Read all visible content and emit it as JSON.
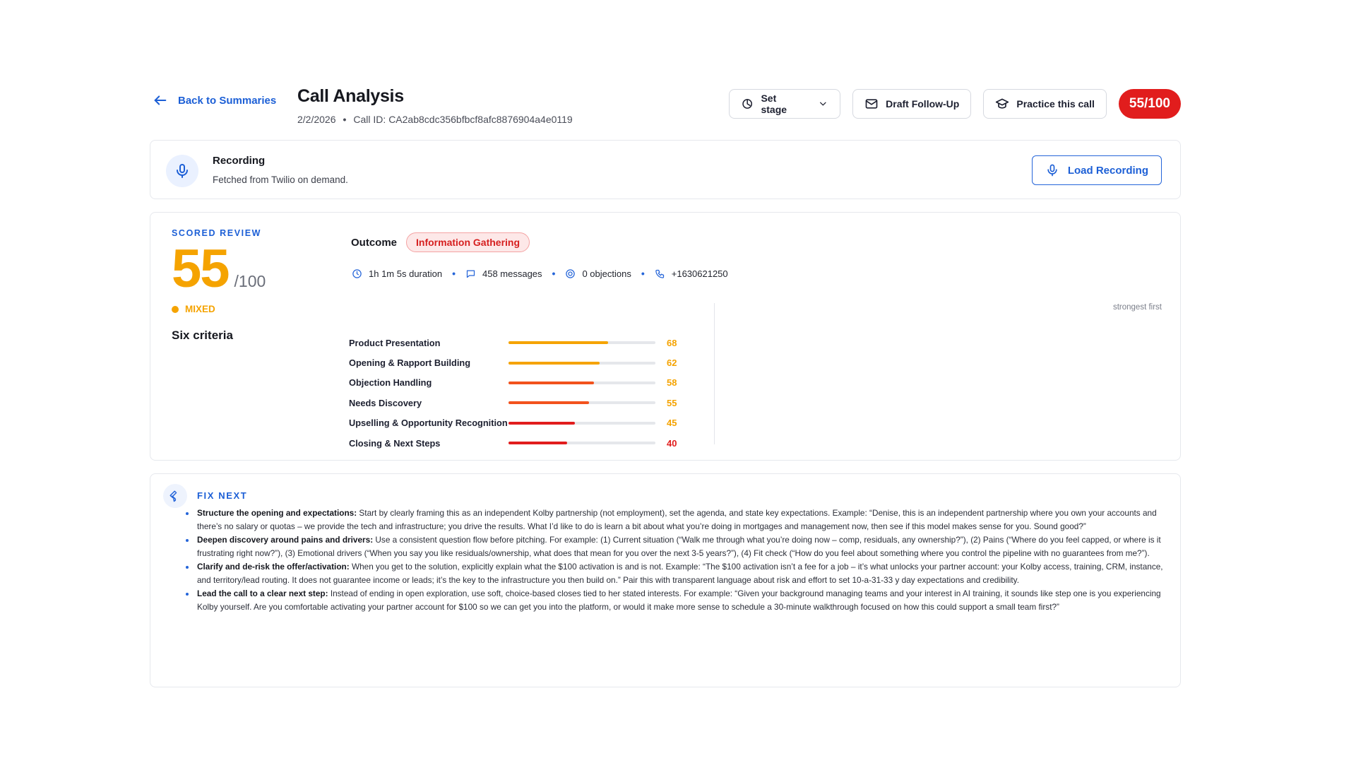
{
  "header": {
    "back_label": "Back to Summaries",
    "title": "Call Analysis",
    "date": "2/2/2026",
    "separator": "•",
    "call_id": "Call ID: CA2ab8cdc356bfbcf8afc8876904a4e0119",
    "set_stage_label": "Set stage",
    "draft_followup_label": "Draft Follow-Up",
    "practice_label": "Practice this call",
    "score_badge": "55/100"
  },
  "recording": {
    "title": "Recording",
    "subtitle": "Fetched from Twilio on demand.",
    "load_label": "Load Recording"
  },
  "review": {
    "section_label": "SCORED REVIEW",
    "score": "55",
    "score_max": "/100",
    "rating": "MIXED",
    "criteria_title": "Six criteria",
    "outcome_label": "Outcome",
    "outcome_value": "Information Gathering",
    "stats": {
      "duration": "1h 1m 5s duration",
      "messages": "458 messages",
      "objections": "0 objections",
      "phone": "+1630621250"
    },
    "sort_note": "strongest first",
    "criteria": [
      {
        "name": "Product Presentation",
        "score": 68,
        "color": "#f5a300"
      },
      {
        "name": "Opening & Rapport Building",
        "score": 62,
        "color": "#f5a300"
      },
      {
        "name": "Objection Handling",
        "score": 58,
        "color": "#f2521d"
      },
      {
        "name": "Needs Discovery",
        "score": 55,
        "color": "#f2521d"
      },
      {
        "name": "Upselling & Opportunity Recognition",
        "score": 45,
        "color": "#e11d1d"
      },
      {
        "name": "Closing & Next Steps",
        "score": 40,
        "color": "#e11d1d"
      }
    ],
    "value_colors": [
      "#f5a300",
      "#f5a300",
      "#f5a300",
      "#f5a300",
      "#f5a300",
      "#e11d1d"
    ]
  },
  "fix_next": {
    "label": "FIX NEXT",
    "items": [
      {
        "heading": "Structure the opening and expectations:",
        "text": " Start by clearly framing this as an independent Kolby partnership (not employment), set the agenda, and state key expectations. Example: “Denise, this is an independent partnership where you own your accounts and there’s no salary or quotas – we provide the tech and infrastructure; you drive the results. What I’d like to do is learn a bit about what you’re doing in mortgages and management now, then see if this model makes sense for you. Sound good?”"
      },
      {
        "heading": "Deepen discovery around pains and drivers:",
        "text": " Use a consistent question flow before pitching. For example: (1) Current situation (“Walk me through what you’re doing now – comp, residuals, any ownership?”), (2) Pains (“Where do you feel capped, or where is it frustrating right now?”), (3) Emotional drivers (“When you say you like residuals/ownership, what does that mean for you over the next 3-5 years?”), (4) Fit check (“How do you feel about something where you control the pipeline with no guarantees from me?”)."
      },
      {
        "heading": "Clarify and de-risk the offer/activation:",
        "text": " When you get to the solution, explicitly explain what the $100 activation is and is not. Example: “The $100 activation isn’t a fee for a job – it’s what unlocks your partner account: your Kolby access, training, CRM, instance, and territory/lead routing. It does not guarantee income or leads; it’s the key to the infrastructure you then build on.” Pair this with transparent language about risk and effort to set 10-a-31-33 y day expectations and credibility."
      },
      {
        "heading": "Lead the call to a clear next step:",
        "text": " Instead of ending in open exploration, use soft, choice-based closes tied to her stated interests. For example: “Given your background managing teams and your interest in AI training, it sounds like step one is you experiencing Kolby yourself. Are you comfortable activating your partner account for $100 so we can get you into the platform, or would it make more sense to schedule a 30-minute walkthrough focused on how this could support a small team first?”"
      }
    ]
  }
}
